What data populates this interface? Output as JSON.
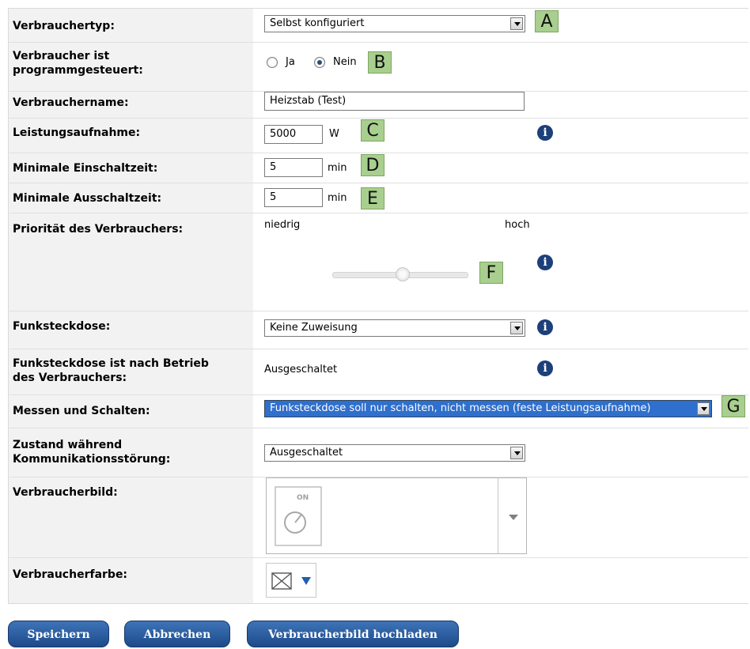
{
  "form": {
    "consumer_type": {
      "label": "Verbrauchertyp:",
      "value": "Selbst konfiguriert",
      "marker": "A"
    },
    "program_controlled": {
      "label": "Verbraucher ist programmgesteuert:",
      "option_yes": "Ja",
      "option_no": "Nein",
      "selected": "Nein",
      "marker": "B"
    },
    "consumer_name": {
      "label": "Verbrauchername:",
      "value": "Heizstab (Test)"
    },
    "power": {
      "label": "Leistungsaufnahme:",
      "value": "5000",
      "unit": "W",
      "marker": "C"
    },
    "min_on": {
      "label": "Minimale Einschaltzeit:",
      "value": "5",
      "unit": "min",
      "marker": "D"
    },
    "min_off": {
      "label": "Minimale Ausschaltzeit:",
      "value": "5",
      "unit": "min",
      "marker": "E"
    },
    "priority": {
      "label": "Priorität des Verbrauchers:",
      "low": "niedrig",
      "high": "hoch",
      "level": 0.5,
      "marker": "F"
    },
    "socket": {
      "label": "Funksteckdose:",
      "value": "Keine Zuweisung"
    },
    "socket_after": {
      "label": "Funksteckdose ist nach Betrieb des Verbrauchers:",
      "value": "Ausgeschaltet"
    },
    "measure_switch": {
      "label": "Messen und Schalten:",
      "value": "Funksteckdose soll nur schalten, nicht messen (feste Leistungsaufnahme)",
      "marker": "G"
    },
    "comm_failure": {
      "label": "Zustand während Kommunikationsstörung:",
      "value": "Ausgeschaltet"
    },
    "image": {
      "label": "Verbraucherbild:",
      "icon_text": "ON"
    },
    "color": {
      "label": "Verbraucherfarbe:"
    }
  },
  "buttons": {
    "save": "Speichern",
    "cancel": "Abbrechen",
    "upload": "Verbraucherbild hochladen"
  },
  "info_symbol": "i",
  "colors": {
    "marker": "#a8cf8e",
    "button": "#2a5b9c",
    "info": "#1d3f7a",
    "highlight": "#2f6fcd"
  }
}
